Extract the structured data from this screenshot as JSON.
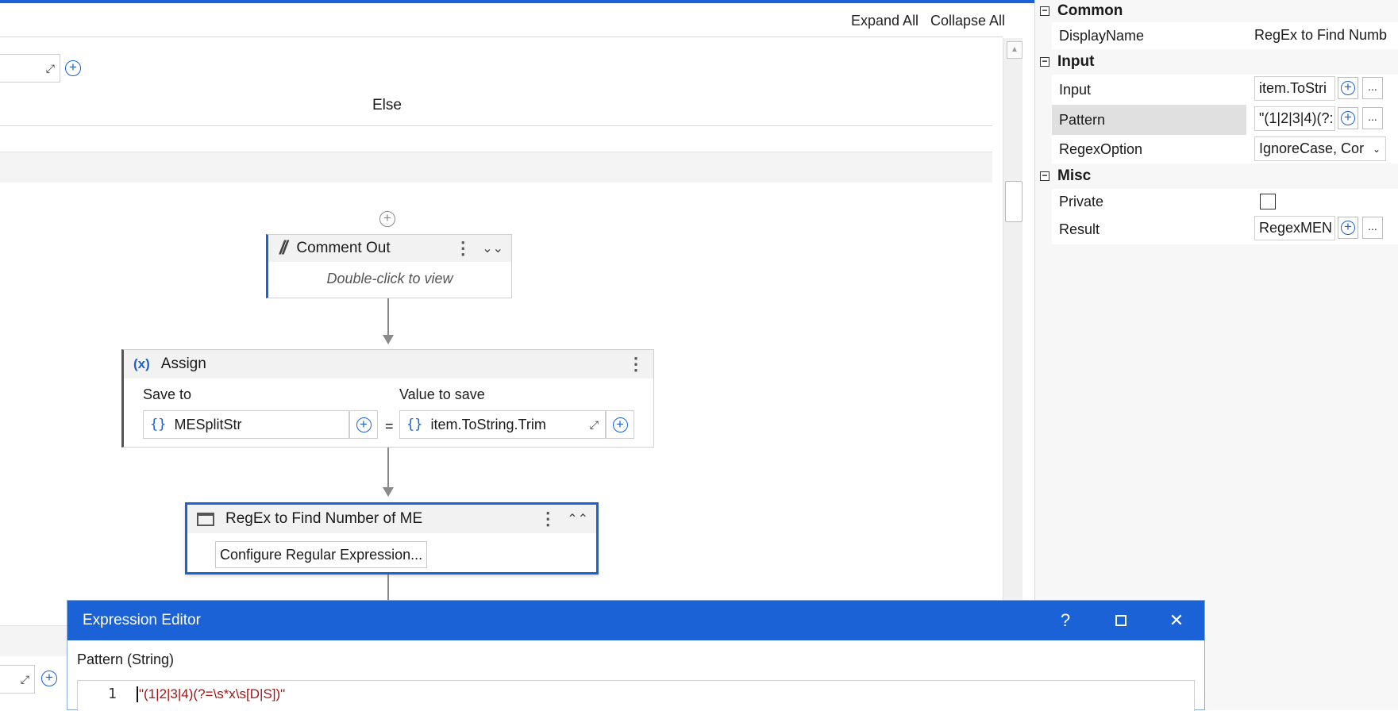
{
  "designer": {
    "expand_all": "Expand All",
    "collapse_all": "Collapse All",
    "else_label": "Else"
  },
  "comment_out": {
    "title": "Comment Out",
    "hint": "Double-click to view"
  },
  "assign": {
    "title": "Assign",
    "save_to_label": "Save to",
    "value_label": "Value to save",
    "save_to_value": "MESplitStr",
    "equals": "=",
    "value_value": "item.ToString.Trim"
  },
  "regex_activity": {
    "title": "RegEx to Find Number of ME",
    "configure_button": "Configure Regular Expression..."
  },
  "properties": {
    "common": {
      "label": "Common",
      "display_name_label": "DisplayName",
      "display_name_value": "RegEx to Find Numb"
    },
    "input": {
      "label": "Input",
      "input_label": "Input",
      "input_value": "item.ToStri",
      "pattern_label": "Pattern",
      "pattern_value": "\"(1|2|3|4)(?:",
      "regex_option_label": "RegexOption",
      "regex_option_value": "IgnoreCase, Cor"
    },
    "misc": {
      "label": "Misc",
      "private_label": "Private",
      "private_checked": false,
      "result_label": "Result",
      "result_value": "RegexMEN"
    },
    "ellipsis": "..."
  },
  "expression_editor": {
    "title": "Expression Editor",
    "help": "?",
    "field_label": "Pattern (String)",
    "line_number": "1",
    "code": "\"(1|2|3|4)(?=\\s*x\\s[D|S])\""
  },
  "colors": {
    "accent": "#1a62d6",
    "code_string": "#a31515"
  }
}
